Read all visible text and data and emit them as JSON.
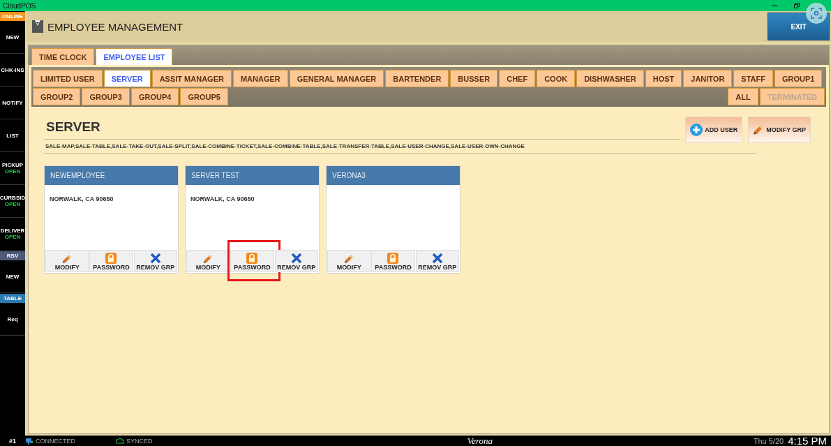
{
  "window": {
    "title": "CloudPOS"
  },
  "sidebar": {
    "items": [
      {
        "kind": "label",
        "label": "ONLINE",
        "color": "#f7941d"
      },
      {
        "kind": "button",
        "label": "NEW"
      },
      {
        "kind": "button",
        "label": "CHK-INS"
      },
      {
        "kind": "button",
        "label": "NOTIFY"
      },
      {
        "kind": "button",
        "label": "LIST"
      },
      {
        "kind": "status",
        "label": "PICKUP",
        "status": "OPEN"
      },
      {
        "kind": "status",
        "label": "CURBSID",
        "status": "OPEN"
      },
      {
        "kind": "status",
        "label": "DELIVER",
        "status": "OPEN"
      },
      {
        "kind": "label",
        "label": "RSV",
        "color": "#4e5a78"
      },
      {
        "kind": "button",
        "label": "NEW"
      },
      {
        "kind": "label",
        "label": "TABLE",
        "color": "#2a7bb0"
      },
      {
        "kind": "button",
        "label": "Req"
      }
    ]
  },
  "header": {
    "title": "EMPLOYEE MANAGEMENT",
    "exit": "EXIT"
  },
  "tabs": [
    {
      "label": "TIME CLOCK",
      "selected": false
    },
    {
      "label": "EMPLOYEE LIST",
      "selected": true
    }
  ],
  "role_tabs": [
    [
      {
        "label": "LIMITED USER",
        "selected": false
      },
      {
        "label": "SERVER",
        "selected": true
      },
      {
        "label": "ASSIT MANAGER",
        "selected": false
      },
      {
        "label": "MANAGER",
        "selected": false
      },
      {
        "label": "GENERAL MANAGER",
        "selected": false
      },
      {
        "label": "BARTENDER",
        "selected": false
      },
      {
        "label": "BUSSER",
        "selected": false
      },
      {
        "label": "CHEF",
        "selected": false
      },
      {
        "label": "COOK",
        "selected": false
      },
      {
        "label": "DISHWASHER",
        "selected": false
      },
      {
        "label": "HOST",
        "selected": false
      },
      {
        "label": "JANITOR",
        "selected": false
      },
      {
        "label": "STAFF",
        "selected": false
      },
      {
        "label": "GROUP1",
        "selected": false
      }
    ],
    [
      {
        "label": "GROUP2",
        "selected": false
      },
      {
        "label": "GROUP3",
        "selected": false
      },
      {
        "label": "GROUP4",
        "selected": false
      },
      {
        "label": "GROUP5",
        "selected": false
      }
    ]
  ],
  "filters": [
    {
      "label": "ALL",
      "disabled": false
    },
    {
      "label": "TERMINATED",
      "disabled": true
    }
  ],
  "group": {
    "title": "SERVER",
    "permissions": "SALE-MAP,SALE-TABLE,SALE-TAKE-OUT,SALE-SPLIT,SALE-COMBINE-TICKET,SALE-COMBINE-TABLE,SALE-TRANSFER-TABLE,SALE-USER-CHANGE,SALE-USER-OWN-CHANGE",
    "buttons": [
      {
        "kind": "add",
        "label": "ADD USER"
      },
      {
        "kind": "modify",
        "label": "MODIFY GRP"
      }
    ]
  },
  "employees": [
    {
      "name": "NEWEMPLOYEE",
      "address": "NORWALK, CA 90650",
      "actions": [
        {
          "kind": "modify",
          "label": "MODIFY",
          "highlighted": false
        },
        {
          "kind": "password",
          "label": "PASSWORD",
          "highlighted": false
        },
        {
          "kind": "remove",
          "label": "REMOV GRP",
          "highlighted": false
        }
      ]
    },
    {
      "name": "SERVER TEST",
      "address": "NORWALK, CA 90650",
      "actions": [
        {
          "kind": "modify",
          "label": "MODIFY",
          "highlighted": false
        },
        {
          "kind": "password",
          "label": "PASSWORD",
          "highlighted": true
        },
        {
          "kind": "remove",
          "label": "REMOV GRP",
          "highlighted": false
        }
      ]
    },
    {
      "name": "VERONA3",
      "actions": [
        {
          "kind": "modify",
          "label": "MODIFY",
          "highlighted": false
        },
        {
          "kind": "password",
          "label": "PASSWORD",
          "highlighted": false
        },
        {
          "kind": "remove",
          "label": "REMOV GRP",
          "highlighted": false
        }
      ]
    }
  ],
  "status_bar": {
    "terminal": "#1",
    "connection": "CONNECTED",
    "sync": "SYNCED",
    "store": "Verona",
    "date": "Thu 5/20",
    "time": "4:15 PM"
  }
}
